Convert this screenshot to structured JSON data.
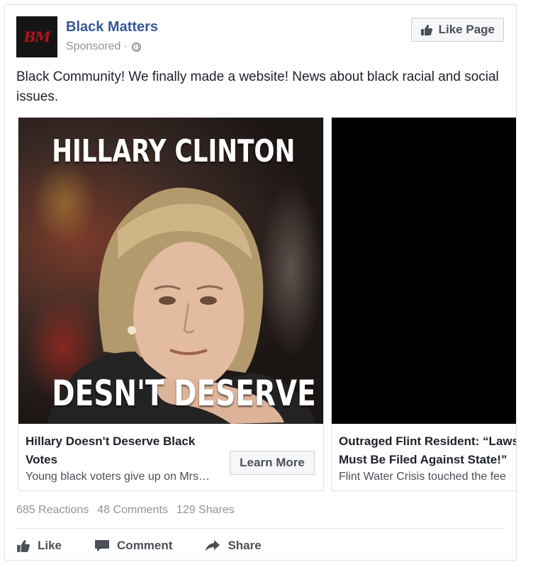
{
  "post": {
    "page_name": "Black Matters",
    "avatar_text": "BM",
    "sponsored_label": "Sponsored",
    "separator": "·",
    "like_page_label": "Like Page",
    "text": "Black Community! We finally made a website! News about black racial and social issues."
  },
  "carousel": {
    "items": [
      {
        "image_headline_top": "HILLARY CLINTON",
        "image_headline_bottom": "DESN'T DESERVE BLACK VOTI",
        "title": "Hillary Doesn't Deserve Black Votes",
        "description": "Young black voters give up on Mrs…",
        "cta_label": "Learn More"
      },
      {
        "title": "Outraged Flint Resident: “Laws Must Be Filed Against State!”",
        "title_line1": "Outraged Flint Resident: “Laws",
        "title_line2": "Must Be Filed Against State!”",
        "description": "Flint Water Crisis touched the fee"
      }
    ]
  },
  "stats": {
    "reactions": "685 Reactions",
    "comments": "48 Comments",
    "shares": "129 Shares"
  },
  "actions": {
    "like": "Like",
    "comment": "Comment",
    "share": "Share"
  },
  "colors": {
    "link_blue": "#365899",
    "muted_gray": "#90949c",
    "button_text": "#4b4f56",
    "avatar_red": "#b0141a"
  },
  "icons": [
    "globe-icon",
    "thumbs-up-icon",
    "comment-icon",
    "share-arrow-icon"
  ]
}
